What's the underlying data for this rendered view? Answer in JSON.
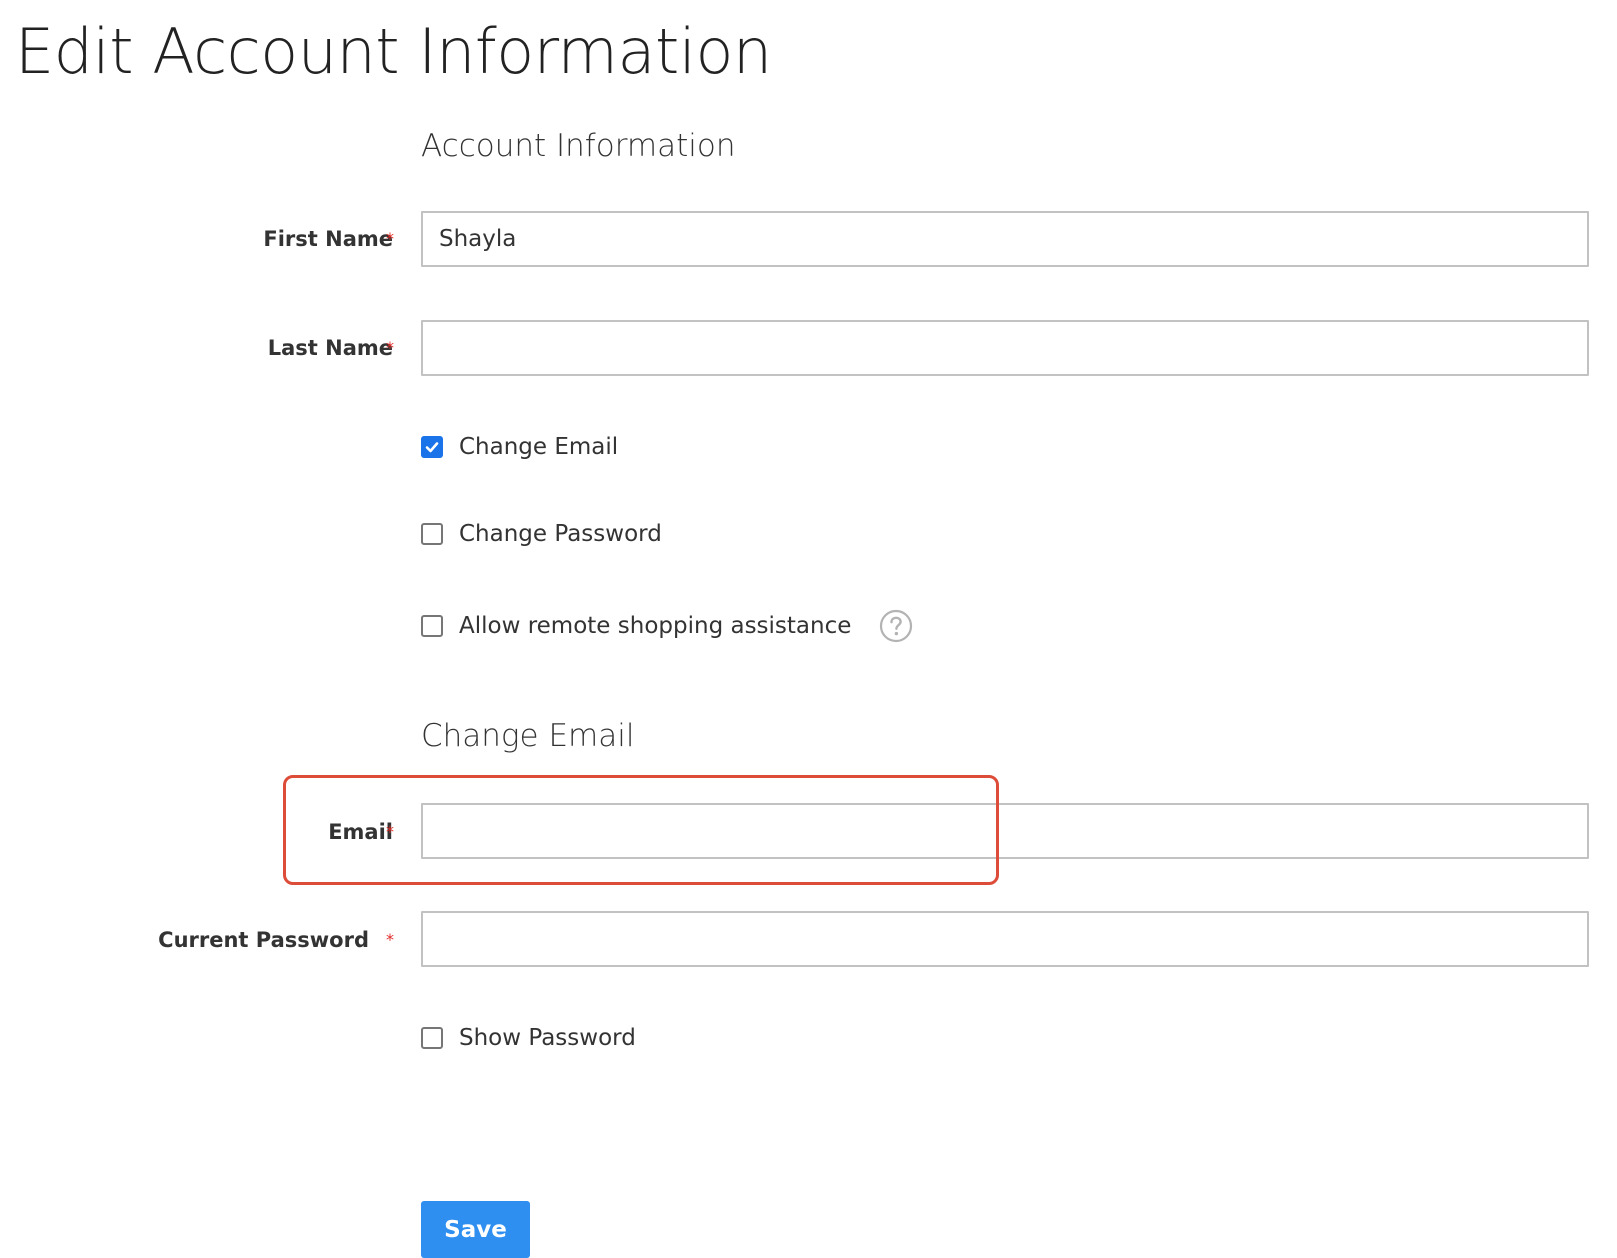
{
  "page_title": "Edit Account Information",
  "account_section": {
    "title": "Account Information",
    "first_name": {
      "label": "First Name",
      "value": "Shayla",
      "required_mark": "*"
    },
    "last_name": {
      "label": "Last Name",
      "value": "",
      "required_mark": "*"
    },
    "change_email": {
      "label": "Change Email",
      "checked": true
    },
    "change_password": {
      "label": "Change Password",
      "checked": false
    },
    "remote_assistance": {
      "label": "Allow remote shopping assistance",
      "checked": false,
      "icon": "question-circle-icon"
    }
  },
  "email_section": {
    "title": "Change Email",
    "email": {
      "label": "Email",
      "value": "",
      "required_mark": "*"
    },
    "current_password": {
      "label": "Current Password",
      "value": "",
      "required_mark": "*"
    },
    "show_password": {
      "label": "Show Password",
      "checked": false
    }
  },
  "actions": {
    "save_label": "Save"
  },
  "colors": {
    "accent": "#1a73e8",
    "button": "#2e8ff0",
    "required": "#e02b27",
    "highlight": "#dd4b39"
  }
}
